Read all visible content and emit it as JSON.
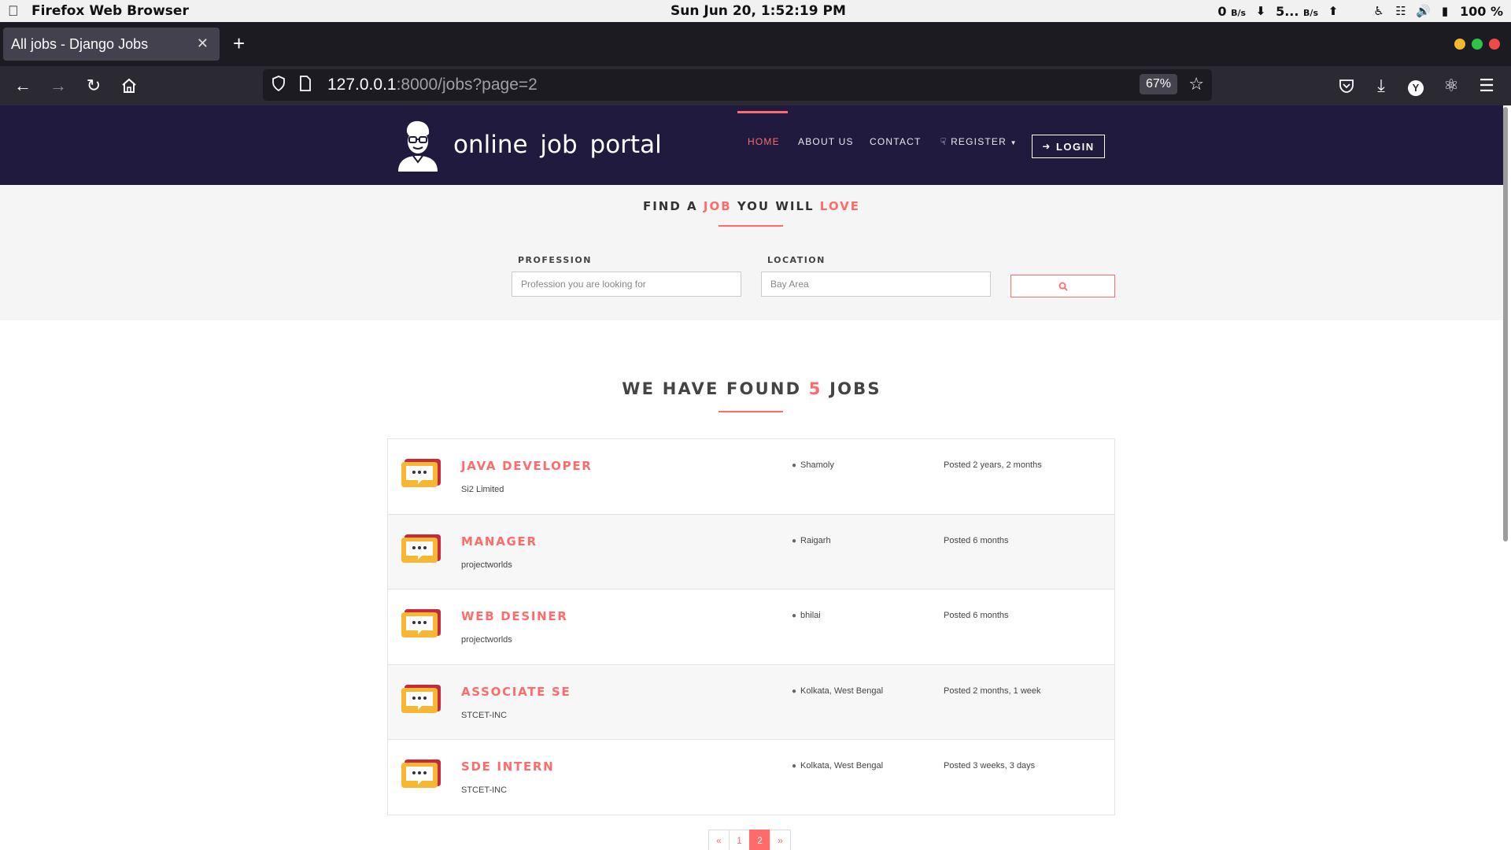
{
  "os": {
    "app_name": "Firefox Web Browser",
    "clock": "Sun Jun 20,  1:52:19 PM",
    "net_down": "0",
    "net_down_unit": "B/s",
    "net_up": "5...",
    "net_up_unit": "B/s",
    "battery": "100 %"
  },
  "browser": {
    "tab_title": "All jobs - Django Jobs",
    "url_host": "127.0.0.1",
    "url_rest": ":8000/jobs?page=2",
    "zoom": "67%"
  },
  "site": {
    "logo_text": "online job portal",
    "nav": {
      "home": "HOME",
      "about": "ABOUT US",
      "contact": "CONTACT",
      "register": "REGISTER",
      "login": "LOGIN"
    },
    "search": {
      "title_pre": "FIND A ",
      "title_job": "JOB",
      "title_mid": " YOU WILL ",
      "title_love": "LOVE",
      "profession_label": "PROFESSION",
      "profession_placeholder": "Profession you are looking for",
      "location_label": "LOCATION",
      "location_placeholder": "Bay Area"
    },
    "results": {
      "title_pre": "WE HAVE FOUND ",
      "count": "5",
      "title_post": " JOBS",
      "jobs": [
        {
          "title": "JAVA DEVELOPER",
          "company": "Si2 Limited",
          "location": "Shamoly",
          "posted": "Posted 2 years, 2 months"
        },
        {
          "title": "MANAGER",
          "company": "projectworlds",
          "location": "Raigarh",
          "posted": "Posted 6 months"
        },
        {
          "title": "WEB DESINER",
          "company": "projectworlds",
          "location": "bhilai",
          "posted": "Posted 6 months"
        },
        {
          "title": "ASSOCIATE SE",
          "company": "STCET-INC",
          "location": "Kolkata, West Bengal",
          "posted": "Posted 2 months, 1 week"
        },
        {
          "title": "SDE INTERN",
          "company": "STCET-INC",
          "location": "Kolkata, West Bengal",
          "posted": "Posted 3 weeks, 3 days"
        }
      ]
    },
    "pagination": {
      "prev": "«",
      "page1": "1",
      "page2": "2",
      "next": "»"
    }
  },
  "colors": {
    "accent": "#ff6b6b",
    "header_bg": "#1f1a3e",
    "band_bg": "#f5f5f5"
  }
}
